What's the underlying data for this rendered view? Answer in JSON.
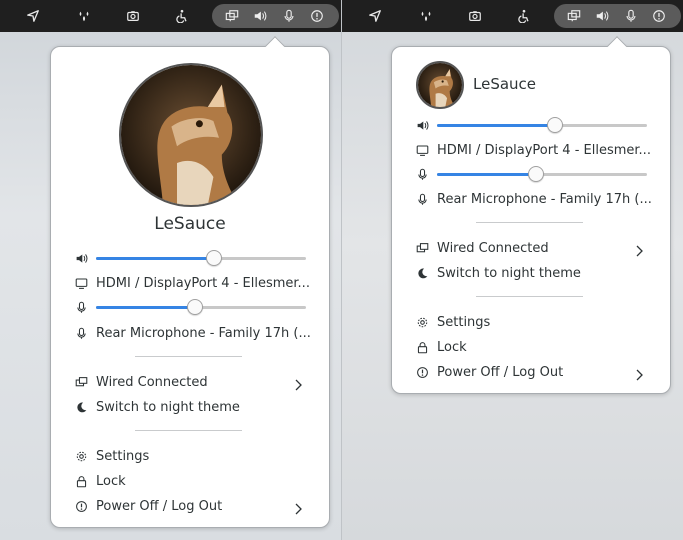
{
  "user": {
    "name": "LeSauce"
  },
  "audio": {
    "output_device": "HDMI / DisplayPort 4 - Ellesmer...",
    "output_level": 0.56,
    "input_device": "Rear Microphone - Family 17h (...",
    "input_level": 0.47
  },
  "network": {
    "label": "Wired Connected"
  },
  "theme": {
    "label": "Switch to night theme"
  },
  "menu": {
    "settings": "Settings",
    "lock": "Lock",
    "power": "Power Off / Log Out"
  },
  "icons": [
    "location-arrow-icon",
    "drops-icon",
    "screenshot-camera-icon",
    "accessibility-icon",
    "network-wired-icon",
    "volume-icon",
    "microphone-icon",
    "power-icon",
    "display-icon",
    "moon-icon",
    "gear-icon",
    "lock-icon",
    "chevron-right-icon"
  ],
  "colors": {
    "accent": "#3584e4",
    "topbar": "#1f1f1f",
    "status_pill": "#5b5b5b"
  }
}
